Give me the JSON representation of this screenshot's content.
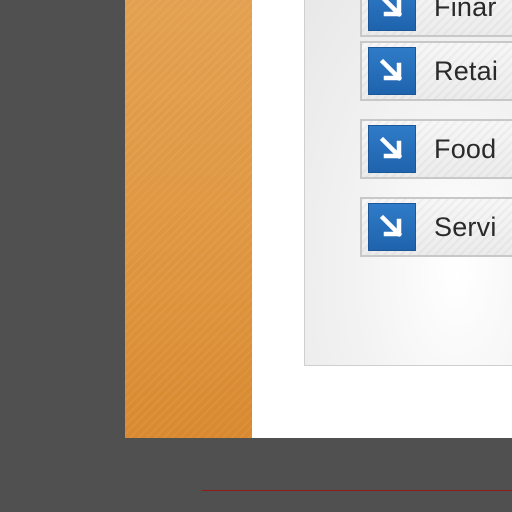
{
  "menu": {
    "items": [
      {
        "label": "Finar",
        "icon": "arrow-down-right-icon"
      },
      {
        "label": "Retai",
        "icon": "arrow-down-right-icon"
      },
      {
        "label": "Food",
        "icon": "arrow-down-right-icon"
      },
      {
        "label": "Servi",
        "icon": "arrow-down-right-icon"
      }
    ]
  },
  "colors": {
    "background": "#505050",
    "accent_strip": "#df9640",
    "icon_blue": "#2a72bf",
    "divider_red": "#8f1b1b"
  }
}
